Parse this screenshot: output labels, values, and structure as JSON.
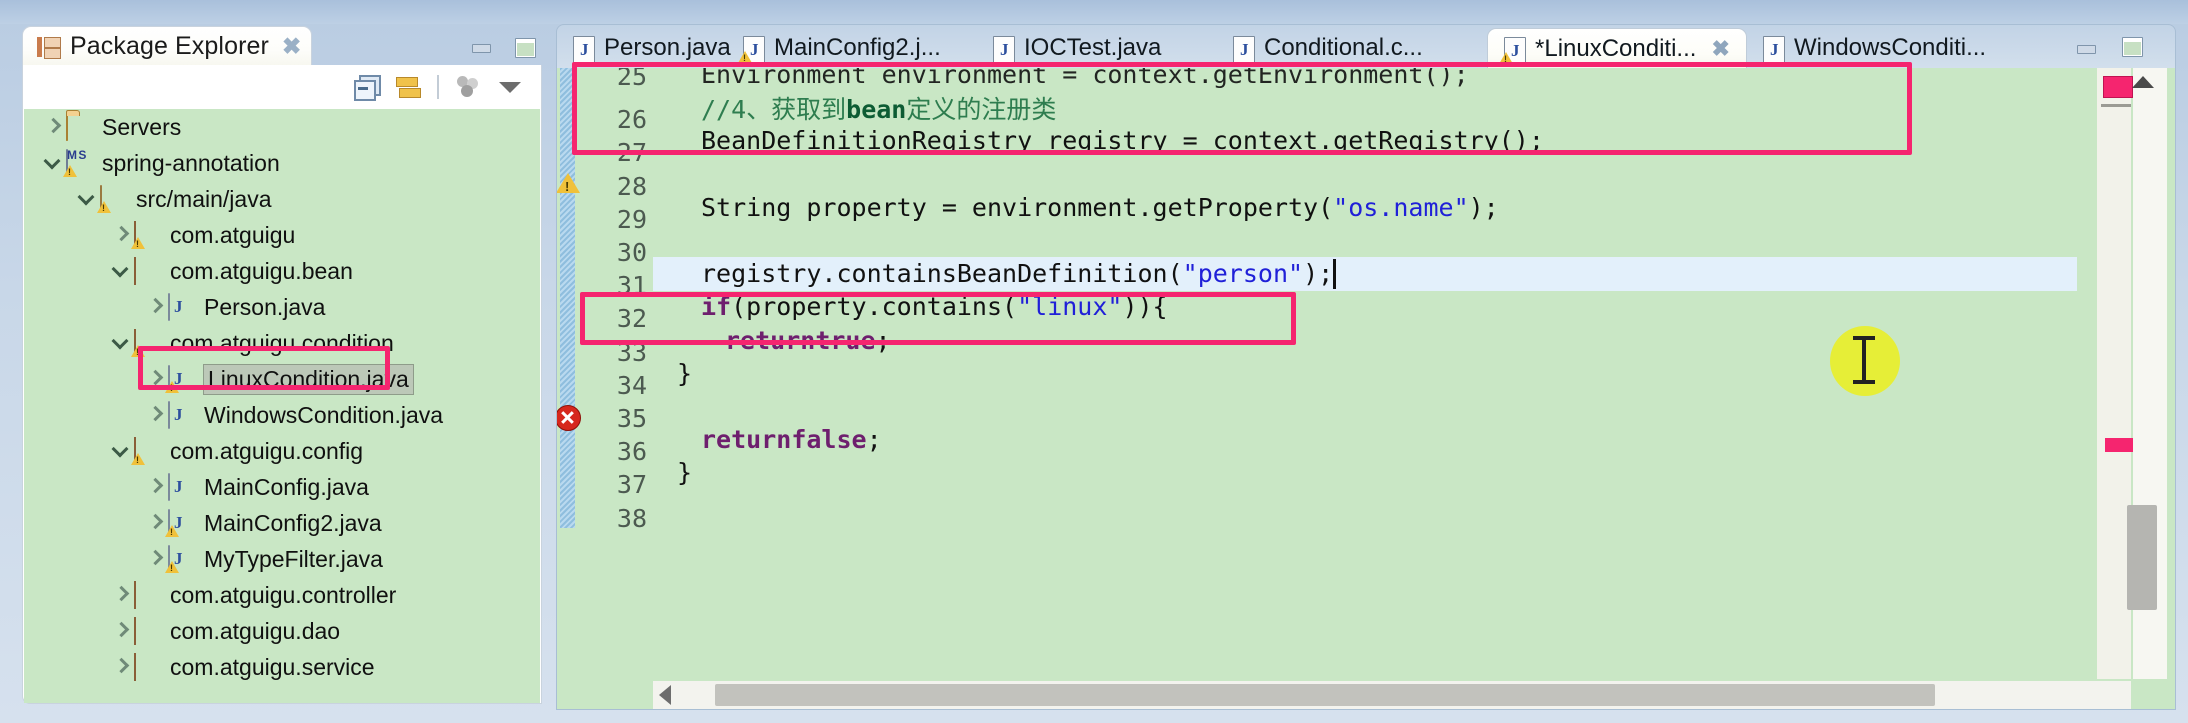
{
  "colors": {
    "highlight_pink": "#f5256f",
    "editor_background": "#c9e7c5",
    "current_line": "#e3f0fb",
    "cursor_blob": "#e8ef2a"
  },
  "left_view": {
    "title": "Package Explorer",
    "close_glyph": "✖",
    "toolbar": [
      {
        "name": "collapse-all-icon"
      },
      {
        "name": "link-with-editor-icon"
      },
      {
        "name": "focus-on-active-task-icon"
      },
      {
        "name": "view-menu-icon"
      }
    ],
    "tree": [
      {
        "label": "Servers",
        "indent": 0,
        "arrow": "right",
        "icon": "folder",
        "warn": false,
        "selected": false
      },
      {
        "label": "spring-annotation",
        "indent": 0,
        "arrow": "down",
        "icon": "project",
        "warn": true,
        "selected": false
      },
      {
        "label": "src/main/java",
        "indent": 1,
        "arrow": "down",
        "icon": "srcfolder",
        "warn": true,
        "selected": false
      },
      {
        "label": "com.atguigu",
        "indent": 2,
        "arrow": "right",
        "icon": "package",
        "warn": true,
        "selected": false
      },
      {
        "label": "com.atguigu.bean",
        "indent": 2,
        "arrow": "down",
        "icon": "package",
        "warn": false,
        "selected": false
      },
      {
        "label": "Person.java",
        "indent": 3,
        "arrow": "right",
        "icon": "java",
        "warn": false,
        "selected": false
      },
      {
        "label": "com.atguigu.condition",
        "indent": 2,
        "arrow": "down",
        "icon": "package",
        "warn": true,
        "selected": false
      },
      {
        "label": "LinuxCondition.java",
        "indent": 3,
        "arrow": "right",
        "icon": "java",
        "warn": true,
        "selected": true
      },
      {
        "label": "WindowsCondition.java",
        "indent": 3,
        "arrow": "right",
        "icon": "java",
        "warn": false,
        "selected": false
      },
      {
        "label": "com.atguigu.config",
        "indent": 2,
        "arrow": "down",
        "icon": "package",
        "warn": true,
        "selected": false
      },
      {
        "label": "MainConfig.java",
        "indent": 3,
        "arrow": "right",
        "icon": "java",
        "warn": false,
        "selected": false
      },
      {
        "label": "MainConfig2.java",
        "indent": 3,
        "arrow": "right",
        "icon": "java",
        "warn": true,
        "selected": false
      },
      {
        "label": "MyTypeFilter.java",
        "indent": 3,
        "arrow": "right",
        "icon": "java",
        "warn": true,
        "selected": false
      },
      {
        "label": "com.atguigu.controller",
        "indent": 2,
        "arrow": "right",
        "icon": "package",
        "warn": false,
        "selected": false
      },
      {
        "label": "com.atguigu.dao",
        "indent": 2,
        "arrow": "right",
        "icon": "package",
        "warn": false,
        "selected": false
      },
      {
        "label": "com.atguigu.service",
        "indent": 2,
        "arrow": "right",
        "icon": "package",
        "warn": false,
        "selected": false
      }
    ]
  },
  "editor": {
    "tabs": [
      {
        "label": "Person.java",
        "icon": "java-file-icon",
        "warn": false,
        "active": false,
        "closable": false
      },
      {
        "label": "MainConfig2.j...",
        "icon": "java-file-icon",
        "warn": true,
        "active": false,
        "closable": false
      },
      {
        "label": "IOCTest.java",
        "icon": "java-file-icon",
        "warn": false,
        "active": false,
        "closable": false
      },
      {
        "label": "Conditional.c...",
        "icon": "class-file-icon",
        "warn": false,
        "active": false,
        "closable": false
      },
      {
        "label": "*LinuxConditi...",
        "icon": "java-file-icon",
        "warn": true,
        "active": true,
        "closable": true
      },
      {
        "label": "WindowsConditi...",
        "icon": "java-file-icon",
        "warn": false,
        "active": false,
        "closable": false
      }
    ],
    "close_glyph": "✖",
    "lines": [
      {
        "num": "25",
        "marker": "",
        "text": "Environment environment = context.getEnvironment();",
        "clipped_top": true
      },
      {
        "num": "26",
        "marker": "",
        "text": "//4、获取到bean定义的注册类"
      },
      {
        "num": "27",
        "marker": "warn",
        "text": "BeanDefinitionRegistry registry = context.getRegistry();"
      },
      {
        "num": "28",
        "marker": "",
        "text": ""
      },
      {
        "num": "29",
        "marker": "",
        "text": "String property = environment.getProperty(\"os.name\");"
      },
      {
        "num": "30",
        "marker": "",
        "text": ""
      },
      {
        "num": "31",
        "marker": "error",
        "text": "registry.containsBeanDefinition(\"person\");",
        "current": true
      },
      {
        "num": "32",
        "marker": "",
        "text": "if(property.contains(\"linux\")){"
      },
      {
        "num": "33",
        "marker": "",
        "text": "return true;"
      },
      {
        "num": "34",
        "marker": "",
        "text": "}"
      },
      {
        "num": "35",
        "marker": "",
        "text": ""
      },
      {
        "num": "36",
        "marker": "",
        "text": "return false;"
      },
      {
        "num": "37",
        "marker": "",
        "text": "}"
      },
      {
        "num": "38",
        "marker": "",
        "text": ""
      }
    ]
  }
}
